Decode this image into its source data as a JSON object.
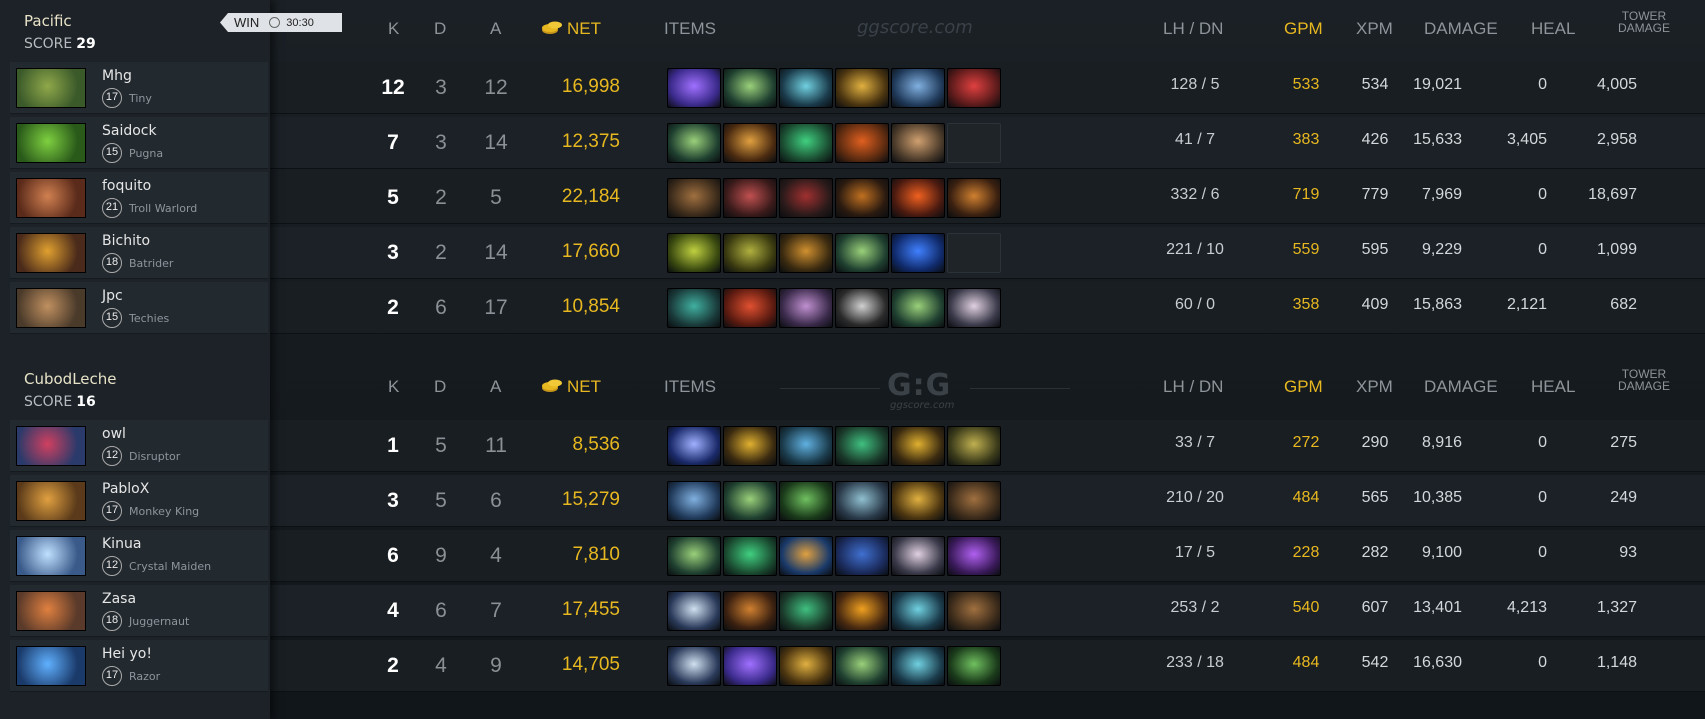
{
  "headers": {
    "k": "K",
    "d": "D",
    "a": "A",
    "net": "NET",
    "items": "ITEMS",
    "lh_dn": "LH  /  DN",
    "gpm": "GPM",
    "xpm": "XPM",
    "damage": "DAMAGE",
    "heal": "HEAL",
    "tower_line1": "TOWER",
    "tower_line2": "DAMAGE"
  },
  "watermark": "ggscore.com",
  "logo": {
    "main": "G:G",
    "sub": "ggscore.com"
  },
  "colors": {
    "gold": "#e8b820",
    "panel": "#1c2227",
    "bg": "#13181c"
  },
  "teams": [
    {
      "name": "Pacific",
      "score_label": "SCORE",
      "score": "29",
      "result": "WIN",
      "duration": "30:30",
      "players": [
        {
          "name": "Mhg",
          "level": "17",
          "hero": "Tiny",
          "k": "12",
          "d": "3",
          "a": "12",
          "net": "16,998",
          "lh_dn": "128  /  5",
          "gpm": "533",
          "xpm": "534",
          "damage": "19,021",
          "heal": "0",
          "tower": "4,005",
          "avatar": [
            "#3b5a2a",
            "#8fa84a"
          ],
          "items": [
            [
              "#3a2a8a",
              "#a070ff"
            ],
            [
              "#1f4030",
              "#9ad07a"
            ],
            [
              "#1a3a4a",
              "#70d0e0"
            ],
            [
              "#4a3410",
              "#e0b040"
            ],
            [
              "#203a5a",
              "#80b0e0"
            ],
            [
              "#5a1a1a",
              "#e04040"
            ]
          ]
        },
        {
          "name": "Saidock",
          "level": "15",
          "hero": "Pugna",
          "k": "7",
          "d": "3",
          "a": "14",
          "net": "12,375",
          "lh_dn": "41  /  7",
          "gpm": "383",
          "xpm": "426",
          "damage": "15,633",
          "heal": "3,405",
          "tower": "2,958",
          "avatar": [
            "#2a5a1a",
            "#7ed040"
          ],
          "items": [
            [
              "#1f4030",
              "#9ad07a"
            ],
            [
              "#4a2a10",
              "#e0a040"
            ],
            [
              "#1a4a30",
              "#40d080"
            ],
            [
              "#5a2a10",
              "#e06020"
            ],
            [
              "#4a3a2a",
              "#d0a070"
            ],
            [
              "",
              ""
            ]
          ]
        },
        {
          "name": "foquito",
          "level": "21",
          "hero": "Troll Warlord",
          "k": "5",
          "d": "2",
          "a": "5",
          "net": "22,184",
          "lh_dn": "332  /  6",
          "gpm": "719",
          "xpm": "779",
          "damage": "7,969",
          "heal": "0",
          "tower": "18,697",
          "avatar": [
            "#5a2a1a",
            "#d08050"
          ],
          "items": [
            [
              "#3a2a1a",
              "#a07040"
            ],
            [
              "#3a1a1a",
              "#c05050"
            ],
            [
              "#2a1a1a",
              "#a03030"
            ],
            [
              "#2a1a10",
              "#c07020"
            ],
            [
              "#4a1a10",
              "#f06020"
            ],
            [
              "#3a2010",
              "#d08030"
            ]
          ]
        },
        {
          "name": "Bichito",
          "level": "18",
          "hero": "Batrider",
          "k": "3",
          "d": "2",
          "a": "14",
          "net": "17,660",
          "lh_dn": "221  /  10",
          "gpm": "559",
          "xpm": "595",
          "damage": "9,229",
          "heal": "0",
          "tower": "1,099",
          "avatar": [
            "#4a2a1a",
            "#e0a030"
          ],
          "items": [
            [
              "#3a4a10",
              "#c0d040"
            ],
            [
              "#3a3a10",
              "#b0b040"
            ],
            [
              "#3a2a10",
              "#d09030"
            ],
            [
              "#1f4030",
              "#9ad07a"
            ],
            [
              "#102a6a",
              "#4080ff"
            ],
            [
              "",
              ""
            ]
          ]
        },
        {
          "name": "Jpc",
          "level": "15",
          "hero": "Techies",
          "k": "2",
          "d": "6",
          "a": "17",
          "net": "10,854",
          "lh_dn": "60  /  0",
          "gpm": "358",
          "xpm": "409",
          "damage": "15,863",
          "heal": "2,121",
          "tower": "682",
          "avatar": [
            "#4a3a2a",
            "#c09060"
          ],
          "items": [
            [
              "#1a3a3a",
              "#40b0a0"
            ],
            [
              "#5a1a10",
              "#e05030"
            ],
            [
              "#3a2a4a",
              "#c090d0"
            ],
            [
              "#2a2a2a",
              "#d0d0d0"
            ],
            [
              "#1f4030",
              "#9ad07a"
            ],
            [
              "#3a3a4a",
              "#e0d0e0"
            ]
          ]
        }
      ]
    },
    {
      "name": "CubodLeche",
      "score_label": "SCORE",
      "score": "16",
      "players": [
        {
          "name": "owl",
          "level": "12",
          "hero": "Disruptor",
          "k": "1",
          "d": "5",
          "a": "11",
          "net": "8,536",
          "lh_dn": "33  /  7",
          "gpm": "272",
          "xpm": "290",
          "damage": "8,916",
          "heal": "0",
          "tower": "275",
          "avatar": [
            "#2a3a6a",
            "#d04060"
          ],
          "items": [
            [
              "#1a2a6a",
              "#a0b0ff"
            ],
            [
              "#3a2a10",
              "#e0b030"
            ],
            [
              "#1a3a4a",
              "#60b0e0"
            ],
            [
              "#1a3a2a",
              "#40c080"
            ],
            [
              "#3a2a10",
              "#e0b030"
            ],
            [
              "#3a3a1a",
              "#c0b050"
            ]
          ]
        },
        {
          "name": "PabloX",
          "level": "17",
          "hero": "Monkey King",
          "k": "3",
          "d": "5",
          "a": "6",
          "net": "15,279",
          "lh_dn": "210  /  20",
          "gpm": "484",
          "xpm": "565",
          "damage": "10,385",
          "heal": "0",
          "tower": "249",
          "avatar": [
            "#5a3a1a",
            "#e0a040"
          ],
          "items": [
            [
              "#203a5a",
              "#80b0e0"
            ],
            [
              "#1f4030",
              "#9ad07a"
            ],
            [
              "#1a3a1a",
              "#70c060"
            ],
            [
              "#2a3a4a",
              "#90c0d0"
            ],
            [
              "#4a3410",
              "#e0b040"
            ],
            [
              "#3a2a1a",
              "#a07040"
            ]
          ]
        },
        {
          "name": "Kinua",
          "level": "12",
          "hero": "Crystal Maiden",
          "k": "6",
          "d": "9",
          "a": "4",
          "net": "7,810",
          "lh_dn": "17  /  5",
          "gpm": "228",
          "xpm": "282",
          "damage": "9,100",
          "heal": "0",
          "tower": "93",
          "avatar": [
            "#3a5a8a",
            "#c0e0ff"
          ],
          "items": [
            [
              "#1f4030",
              "#9ad07a"
            ],
            [
              "#1a4a30",
              "#40d080"
            ],
            [
              "#1a3a6a",
              "#e0a040"
            ],
            [
              "#1a2a5a",
              "#4070d0"
            ],
            [
              "#3a3a4a",
              "#e0d0e0"
            ],
            [
              "#3a1a5a",
              "#b060f0"
            ]
          ]
        },
        {
          "name": "Zasa",
          "level": "18",
          "hero": "Juggernaut",
          "k": "4",
          "d": "6",
          "a": "7",
          "net": "17,455",
          "lh_dn": "253  /  2",
          "gpm": "540",
          "xpm": "607",
          "damage": "13,401",
          "heal": "4,213",
          "tower": "1,327",
          "avatar": [
            "#5a3a2a",
            "#e08040"
          ],
          "items": [
            [
              "#2a3a5a",
              "#d0e0f0"
            ],
            [
              "#3a2010",
              "#d08030"
            ],
            [
              "#1a3a2a",
              "#40c080"
            ],
            [
              "#4a2a10",
              "#f0a020"
            ],
            [
              "#1a3a4a",
              "#70d0e0"
            ],
            [
              "#3a2a1a",
              "#a07040"
            ]
          ]
        },
        {
          "name": "Hei yo!",
          "level": "17",
          "hero": "Razor",
          "k": "2",
          "d": "4",
          "a": "9",
          "net": "14,705",
          "lh_dn": "233  /  18",
          "gpm": "484",
          "xpm": "542",
          "damage": "16,630",
          "heal": "0",
          "tower": "1,148",
          "avatar": [
            "#1a3a6a",
            "#60b0ff"
          ],
          "items": [
            [
              "#2a3a5a",
              "#d0e0f0"
            ],
            [
              "#3a2a8a",
              "#a070ff"
            ],
            [
              "#4a3410",
              "#e0b040"
            ],
            [
              "#1f4030",
              "#9ad07a"
            ],
            [
              "#1a3a4a",
              "#70d0e0"
            ],
            [
              "#1a3a1a",
              "#70c060"
            ]
          ]
        }
      ]
    }
  ]
}
